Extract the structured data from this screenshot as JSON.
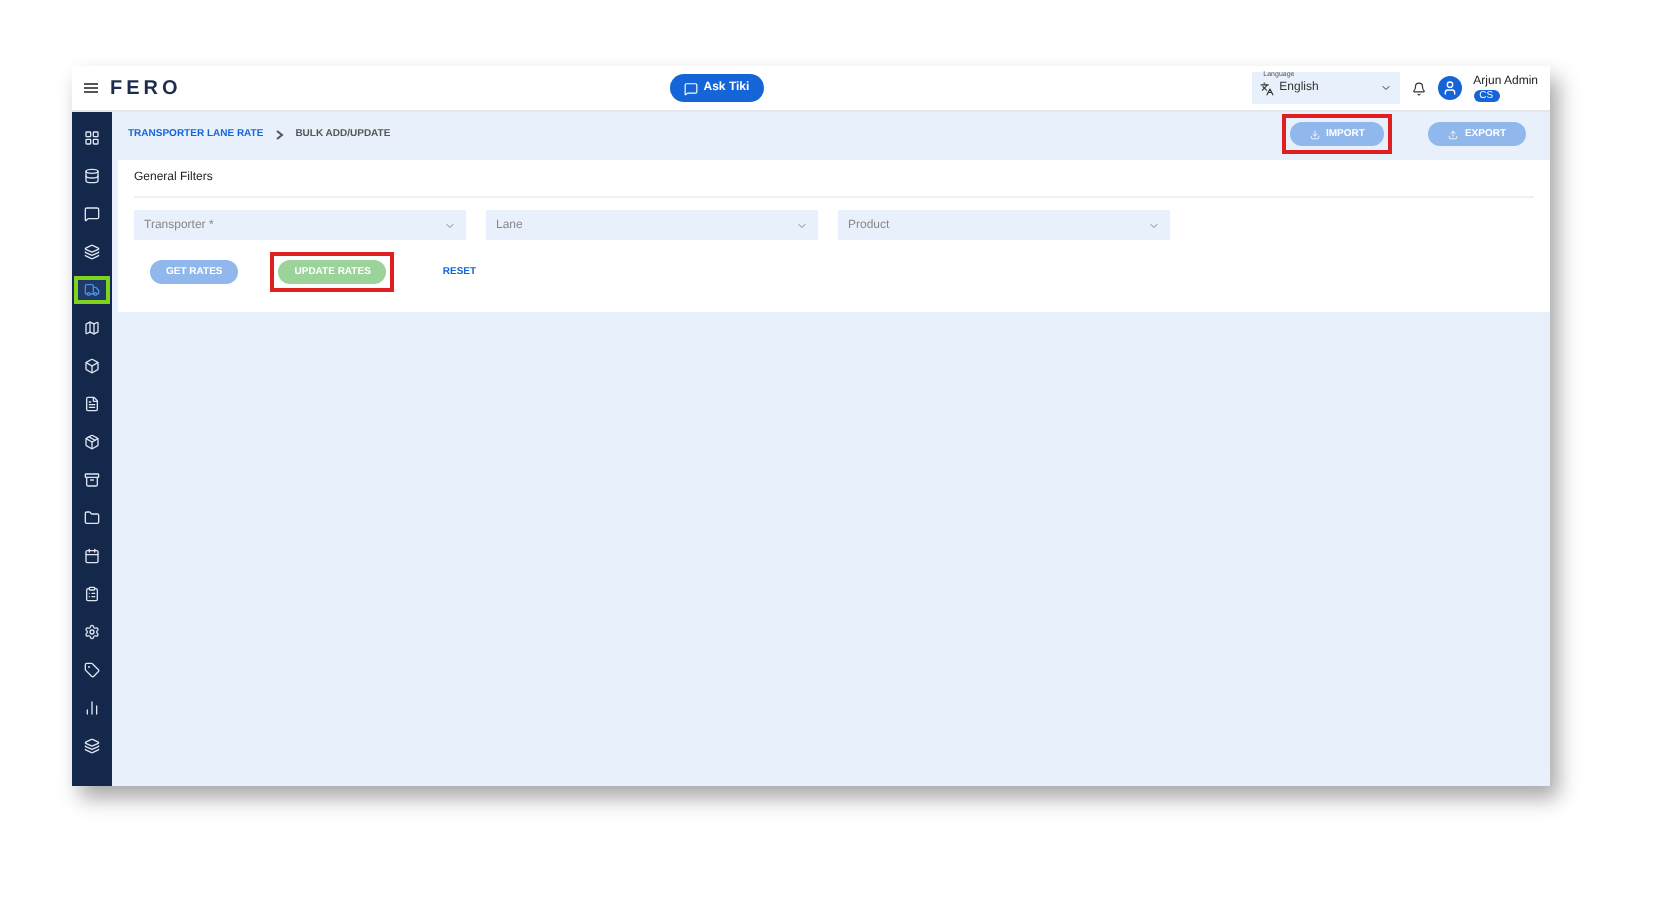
{
  "header": {
    "logo": "FERO",
    "assistant_button": "Ask Tiki",
    "language": {
      "label": "Language",
      "value": "English"
    },
    "user": {
      "name": "Arjun Admin",
      "badge": "CS"
    }
  },
  "sidebar": {
    "items": [
      {
        "selected": false,
        "highlighted": false
      },
      {
        "selected": false,
        "highlighted": false
      },
      {
        "selected": false,
        "highlighted": false
      },
      {
        "selected": false,
        "highlighted": false
      },
      {
        "selected": true,
        "highlighted": true
      },
      {
        "selected": false,
        "highlighted": false
      },
      {
        "selected": false,
        "highlighted": false
      },
      {
        "selected": false,
        "highlighted": false
      },
      {
        "selected": false,
        "highlighted": false
      },
      {
        "selected": false,
        "highlighted": false
      },
      {
        "selected": false,
        "highlighted": false
      },
      {
        "selected": false,
        "highlighted": false
      },
      {
        "selected": false,
        "highlighted": false
      },
      {
        "selected": false,
        "highlighted": false
      },
      {
        "selected": false,
        "highlighted": false
      },
      {
        "selected": false,
        "highlighted": false
      },
      {
        "selected": false,
        "highlighted": false
      }
    ]
  },
  "breadcrumb": [
    "TRANSPORTER LANE RATE",
    "BULK ADD/UPDATE"
  ],
  "actions": [
    {
      "label": "IMPORT",
      "highlighted": true
    },
    {
      "label": "EXPORT",
      "highlighted": false
    }
  ],
  "filters": {
    "title": "General Filters",
    "fields": [
      {
        "placeholder": "Transporter *"
      },
      {
        "placeholder": "Lane"
      },
      {
        "placeholder": "Product"
      }
    ],
    "buttons": [
      {
        "label": "GET RATES",
        "kind": "primary",
        "highlighted": false
      },
      {
        "label": "UPDATE RATES",
        "kind": "success",
        "highlighted": true
      },
      {
        "label": "RESET",
        "kind": "text",
        "highlighted": false
      }
    ]
  }
}
